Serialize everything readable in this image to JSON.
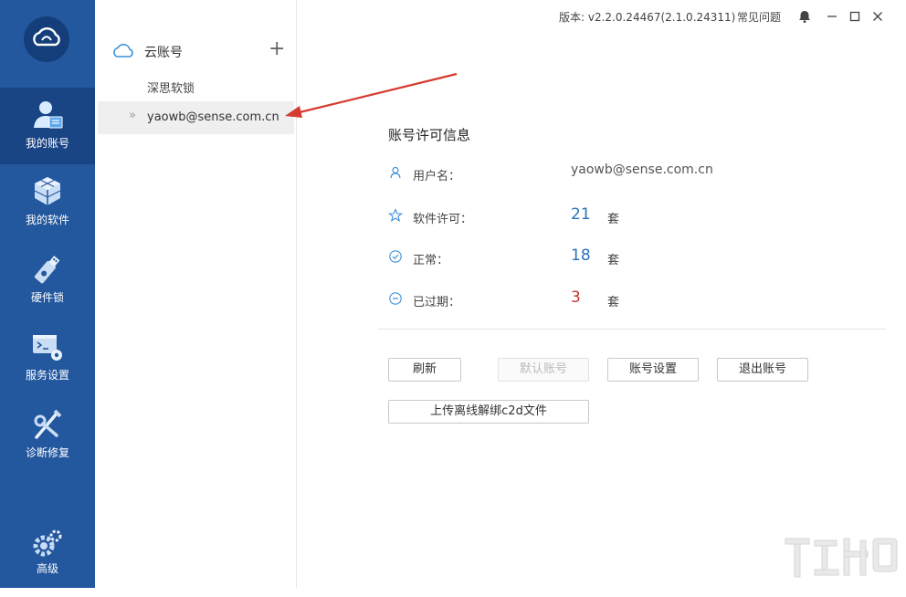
{
  "nav": {
    "items": [
      {
        "label": "我的账号",
        "icon": "user-account-icon",
        "active": true
      },
      {
        "label": "我的软件",
        "icon": "cube-software-icon",
        "active": false
      },
      {
        "label": "硬件锁",
        "icon": "usb-dongle-icon",
        "active": false
      },
      {
        "label": "服务设置",
        "icon": "terminal-gear-icon",
        "active": false
      },
      {
        "label": "诊断修复",
        "icon": "wrench-screwdriver-icon",
        "active": false
      }
    ],
    "advanced_label": "高级"
  },
  "tree": {
    "title": "云账号",
    "add_symbol": "+",
    "nodes": [
      {
        "label": "深思软锁"
      },
      {
        "chevron": "»",
        "label": "yaowb@sense.com.cn"
      }
    ]
  },
  "topbar": {
    "version": "版本: v2.2.0.24467(2.1.0.24311)",
    "faq": "常见问题"
  },
  "info": {
    "title": "账号许可信息",
    "username_label": "用户名：",
    "username_value": "yaowb@sense.com.cn",
    "license_label": "软件许可：",
    "license_value": "21",
    "normal_label": "正常：",
    "normal_value": "18",
    "expired_label": "已过期：",
    "expired_value": "3",
    "unit": "套"
  },
  "buttons": {
    "refresh": "刷新",
    "default_account": "默认账号",
    "account_settings": "账号设置",
    "logout": "退出账号",
    "upload": "上传离线解绑c2d文件"
  },
  "colors": {
    "nav_bg": "#23579e",
    "value_blue": "#2a72b8",
    "value_red": "#c0392b",
    "arrow_red": "#d63b30"
  }
}
